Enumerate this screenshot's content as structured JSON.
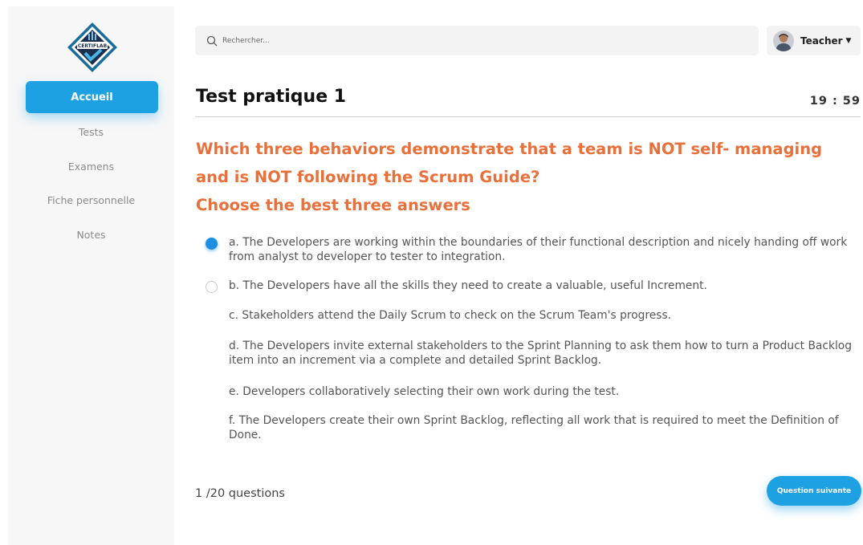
{
  "app": {
    "logo_text": "CERTIFLAB"
  },
  "sidebar": {
    "items": [
      {
        "label": "Accueil",
        "active": true
      },
      {
        "label": "Tests",
        "active": false
      },
      {
        "label": "Examens",
        "active": false
      },
      {
        "label": "Fiche personnelle",
        "active": false
      },
      {
        "label": "Notes",
        "active": false
      }
    ]
  },
  "header": {
    "search_placeholder": "Rechercher...",
    "search_icon": "search-icon",
    "user_name": "Teacher",
    "user_menu_icon": "caret-down-icon"
  },
  "test": {
    "title": "Test pratique 1",
    "timer": "19 : 59",
    "question_lines": [
      "Which three behaviors demonstrate that a team is NOT self- managing",
      "and is NOT following the Scrum Guide?",
      "Choose the best three answers"
    ],
    "answers": [
      {
        "text": "a. The Developers are working within the boundaries of their functional description and nicely handing off work from analyst to developer to tester to integration.",
        "radio": "checked"
      },
      {
        "text": "b. The Developers have all the skills they need to create a valuable, useful Increment.",
        "radio": "unchecked"
      },
      {
        "text": "c. Stakeholders attend the Daily Scrum to check on the Scrum Team's progress.",
        "radio": "none"
      },
      {
        "text": "d. The Developers invite external stakeholders to the Sprint Planning to ask them how to turn a Product Backlog item into an increment via a complete and detailed Sprint Backlog.",
        "radio": "none"
      },
      {
        "text": "e. Developers collaboratively selecting their own work during the test.",
        "radio": "none"
      },
      {
        "text": "f. The Developers create their own Sprint Backlog, reflecting all work that is required to meet the Definition of Done.",
        "radio": "none"
      }
    ],
    "progress": "1 /20 questions",
    "next_label": "Question suivante"
  },
  "colors": {
    "accent": "#1ea1e3",
    "question": "#e8703a"
  }
}
